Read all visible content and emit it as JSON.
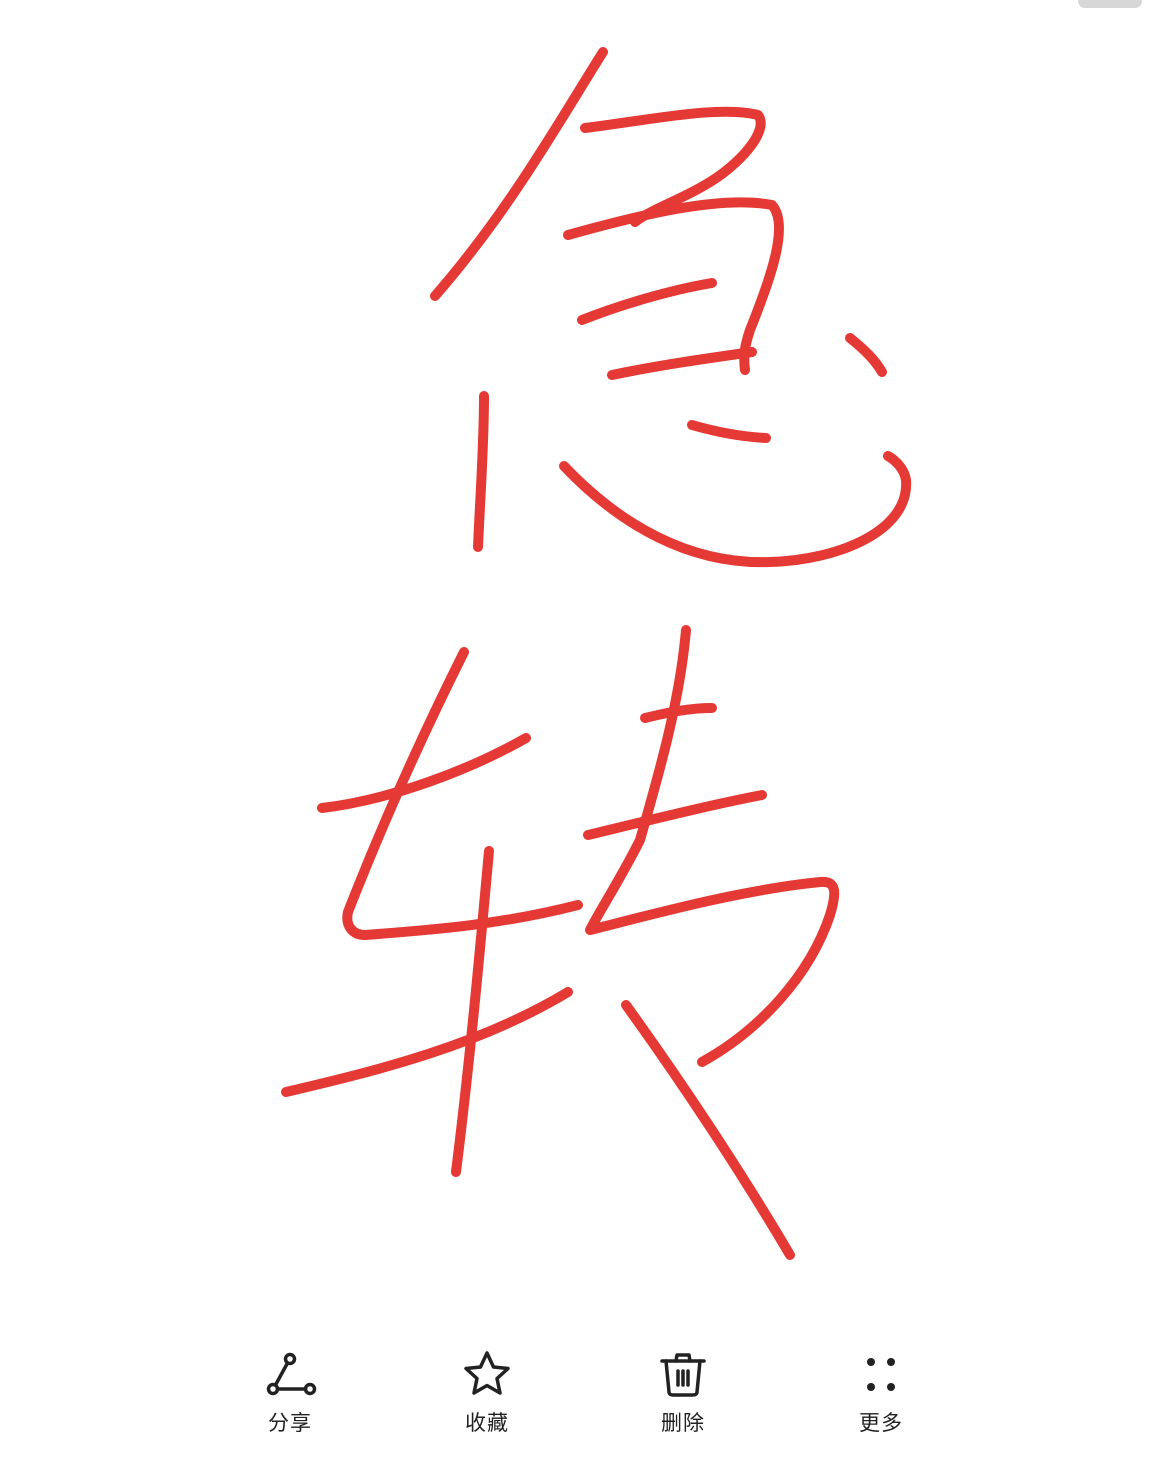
{
  "toolbar": {
    "share": {
      "label": "分享",
      "icon": "share-icon"
    },
    "favorite": {
      "label": "收藏",
      "icon": "star-icon"
    },
    "delete": {
      "label": "删除",
      "icon": "trash-icon"
    },
    "more": {
      "label": "更多",
      "icon": "more-dots-icon"
    }
  },
  "drawing": {
    "ink_color": "#e53935",
    "characters": [
      "急",
      "转"
    ]
  },
  "colors": {
    "background": "#ffffff",
    "icon": "#222222"
  }
}
